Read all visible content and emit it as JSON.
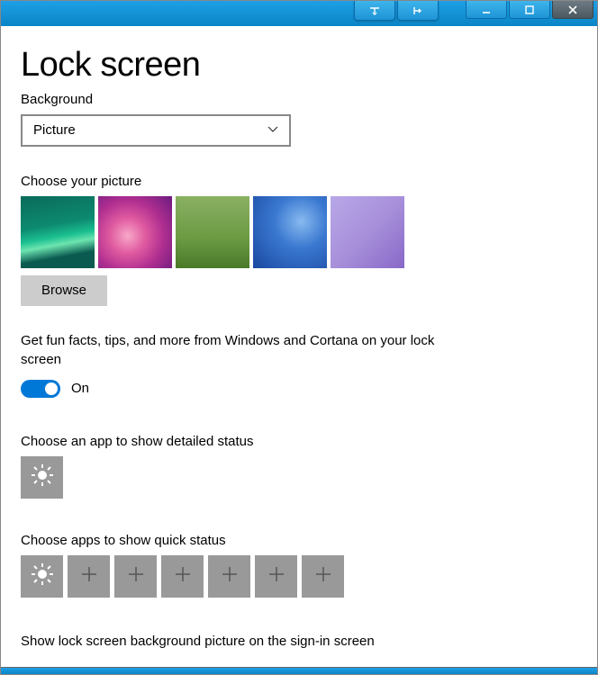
{
  "title": "Lock screen",
  "background": {
    "label": "Background",
    "selected": "Picture"
  },
  "choose_picture": {
    "label": "Choose your picture",
    "browse": "Browse"
  },
  "fun_facts": {
    "text": "Get fun facts, tips, and more from Windows and Cortana on your lock screen",
    "state": "On"
  },
  "detailed": {
    "label": "Choose an app to show detailed status"
  },
  "quick": {
    "label": "Choose apps to show quick status"
  },
  "signin": {
    "label": "Show lock screen background picture on the sign-in screen"
  }
}
